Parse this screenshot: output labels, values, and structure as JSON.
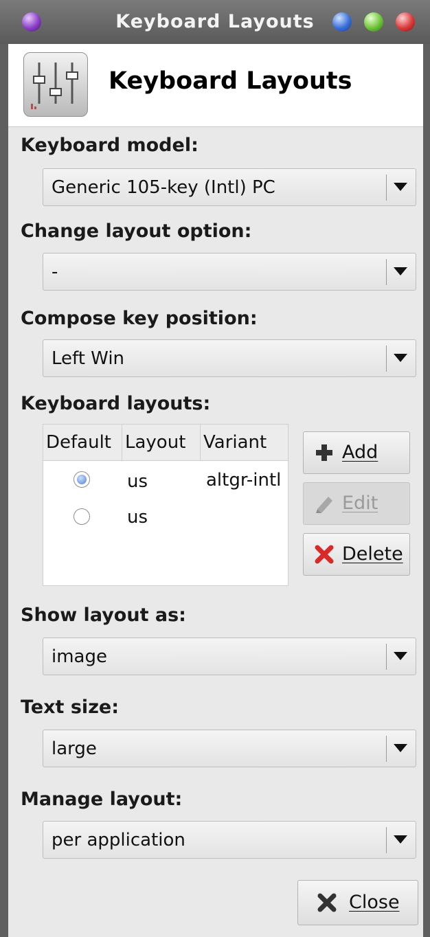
{
  "window": {
    "title": "Keyboard Layouts"
  },
  "header": {
    "title": "Keyboard Layouts",
    "icon": "mixer-sliders-icon"
  },
  "keyboard_model": {
    "label": "Keyboard model:",
    "value": "Generic 105-key (Intl) PC"
  },
  "change_layout_option": {
    "label": "Change layout option:",
    "value": "-"
  },
  "compose_key_position": {
    "label": "Compose key position:",
    "value": "Left Win"
  },
  "keyboard_layouts": {
    "label": "Keyboard layouts:",
    "columns": [
      "Default",
      "Layout",
      "Variant"
    ],
    "rows": [
      {
        "default": true,
        "layout": "us",
        "variant": "altgr-intl"
      },
      {
        "default": false,
        "layout": "us",
        "variant": ""
      }
    ],
    "buttons": {
      "add": "Add",
      "edit": "Edit",
      "delete": "Delete"
    }
  },
  "show_layout_as": {
    "label": "Show layout as:",
    "value": "image"
  },
  "text_size": {
    "label": "Text size:",
    "value": "large"
  },
  "manage_layout": {
    "label": "Manage layout:",
    "value": "per application"
  },
  "footer": {
    "close": "Close"
  },
  "colors": {
    "titlebar": "#666666",
    "window_bg": "#e9e9e9",
    "radio_selected": "#4a7fd0",
    "delete_icon": "#d92a2a"
  }
}
